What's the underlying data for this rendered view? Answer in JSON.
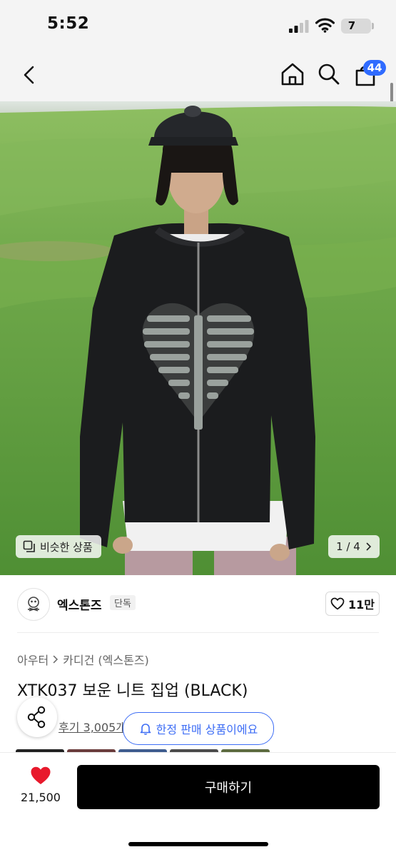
{
  "status_bar": {
    "time": "5:52",
    "battery": "7"
  },
  "nav": {
    "cart_badge": "44",
    "icons": [
      "chevron-left-icon",
      "home-icon",
      "search-icon",
      "shopping-bag-icon"
    ]
  },
  "gallery": {
    "similar_label": "비슷한 상품",
    "counter": "1 / 4"
  },
  "brand": {
    "name": "엑스톤즈",
    "tag": "단독",
    "likes": "11만"
  },
  "product": {
    "breadcrumb": [
      "아우터",
      "카디건 (엑스톤즈)"
    ],
    "title": "XTK037 보운 니트 집업 (BLACK)",
    "review": "후기 3,005개",
    "limited_notice": "한정 판매 상품이에요"
  },
  "bottom_bar": {
    "like_count": "21,500",
    "buy_label": "구매하기"
  },
  "colors": {
    "accent_blue": "#3d6df5",
    "badge_blue": "#2f6bff",
    "heart_red": "#e8192c",
    "buy_button": "#000000"
  }
}
